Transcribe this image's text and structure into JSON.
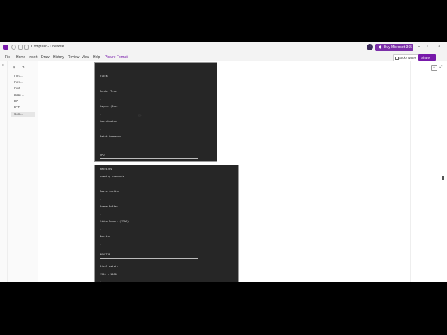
{
  "window": {
    "title": "Computer - OneNote",
    "avatar_initial": "C",
    "buy_label": "Buy Microsoft 365",
    "buy_icon": "diamond-icon",
    "controls": [
      "–",
      "□",
      "×"
    ]
  },
  "menu": {
    "tabs": [
      {
        "label": "File"
      },
      {
        "label": "Home"
      },
      {
        "label": "Insert"
      },
      {
        "label": "Draw"
      },
      {
        "label": "History"
      },
      {
        "label": "Review"
      },
      {
        "label": "View"
      },
      {
        "label": "Help"
      },
      {
        "label": "Picture Format"
      }
    ],
    "sticky_label": "Sticky Notes",
    "share_label": "Share"
  },
  "pages": [
    "Intro...",
    "Intro...",
    "Invit...",
    "Data ...",
    "DP",
    "BTR",
    "Com..."
  ],
  "selected_page": 6,
  "image1": {
    "lines": [
      "↓",
      "Clock",
      "↓",
      "Render Tree",
      "↓",
      "Layout (Box)",
      "↓",
      "Coordinates",
      "↓",
      "Paint Commands",
      "↓",
      "GPU"
    ]
  },
  "image2": {
    "lines": [
      "Receives",
      "drawing commands",
      "↓",
      "Rasterization",
      "↓",
      "Frame Buffer",
      "↓",
      "Video Memory (VRAM)",
      "↓",
      "Monitor",
      "↓",
      "MONITOR",
      "Pixel matrix",
      "1920 × 1080",
      "↓"
    ]
  },
  "colors": {
    "accent": "#7719aa",
    "buy": "#7b2fa8",
    "image_bg": "#262626"
  }
}
